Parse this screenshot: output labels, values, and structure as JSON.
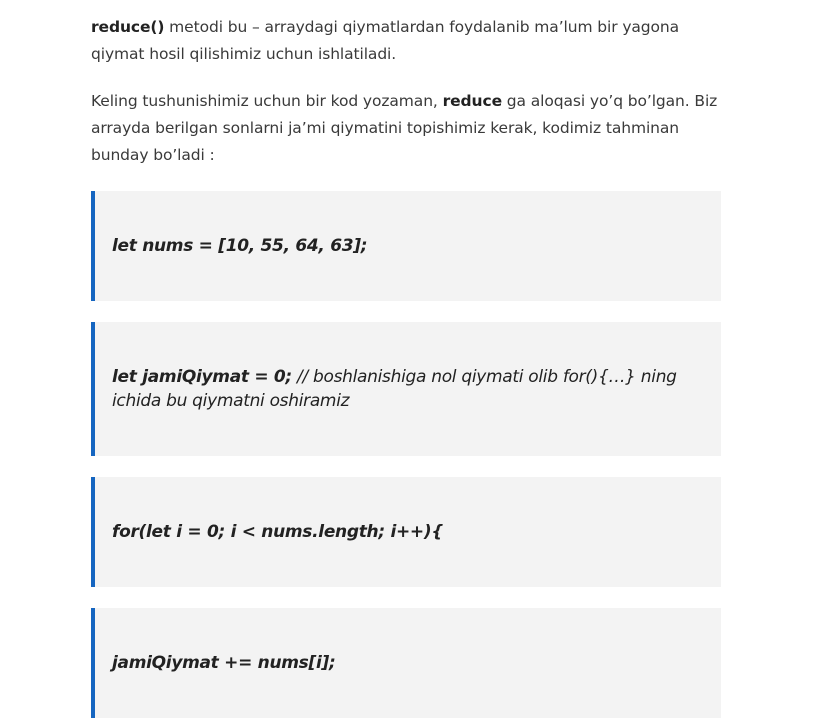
{
  "intro": {
    "p1_bold": "reduce()",
    "p1_text": " metodi bu – arraydagi qiymatlardan foydalanib ma’lum bir yagona qiymat hosil qilishimiz uchun ishlatiladi.",
    "p2_text_before": "Keling tushunishimiz uchun bir kod yozaman, ",
    "p2_bold": "reduce",
    "p2_text_after": " ga aloqasi yo’q bo’lgan. Biz arrayda berilgan sonlarni ja’mi qiymatini topishimiz kerak, kodimiz tahminan bunday bo’ladi :"
  },
  "blockquotes": [
    {
      "code": "let nums = [10, 55, 64, 63];",
      "comment": ""
    },
    {
      "code": "let jamiQiymat = 0;",
      "comment": " // boshlanishiga nol qiymati olib for(){…} ning ichida bu qiymatni oshiramiz"
    },
    {
      "code": "for(let i = 0; i < nums.length; i++){",
      "comment": ""
    },
    {
      "code": "jamiQiymat += nums[i];",
      "comment": ""
    }
  ],
  "colors": {
    "accent_border": "#1565c0",
    "quote_background": "#f3f3f3"
  }
}
